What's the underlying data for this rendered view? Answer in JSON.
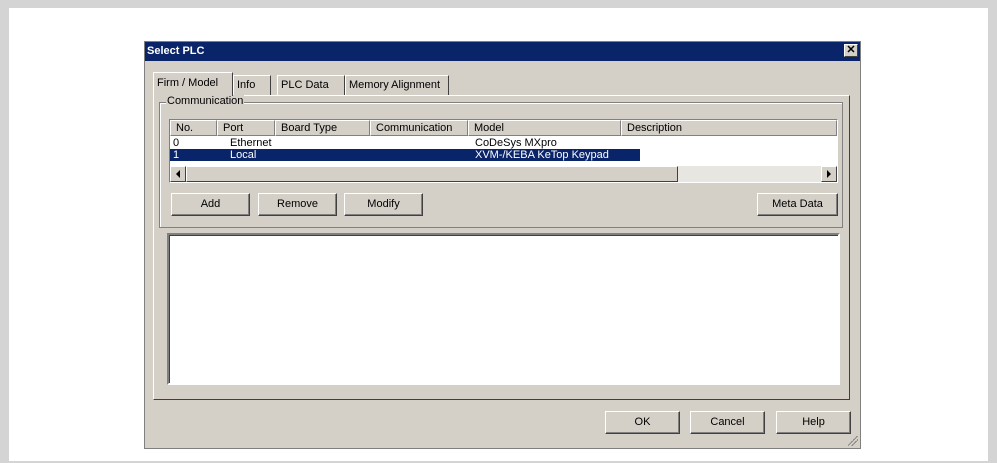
{
  "dialog": {
    "title": "Select PLC",
    "close_glyph": "✕"
  },
  "tabs": [
    {
      "label": "Firm / Model",
      "active": true
    },
    {
      "label": "Info",
      "active": false
    },
    {
      "label": "PLC Data",
      "active": false
    },
    {
      "label": "Memory Alignment",
      "active": false
    }
  ],
  "communication": {
    "group_label": "Communication",
    "columns": [
      "No.",
      "Port",
      "Board Type",
      "Communication",
      "Model",
      "Description"
    ],
    "rows": [
      {
        "no": "0",
        "port": "Ethernet",
        "board_type": "",
        "communication": "",
        "model": "CoDeSys MXpro",
        "description": "",
        "selected": false
      },
      {
        "no": "1",
        "port": "Local",
        "board_type": "",
        "communication": "",
        "model": "XVM-/KEBA KeTop Keypad",
        "description": "",
        "selected": true
      }
    ],
    "scroll_left_icon": "arrow-left",
    "scroll_right_icon": "arrow-right"
  },
  "list_buttons": {
    "add": "Add",
    "remove": "Remove",
    "modify": "Modify",
    "meta_data": "Meta Data"
  },
  "footer_buttons": {
    "ok": "OK",
    "cancel": "Cancel",
    "help": "Help"
  },
  "colors": {
    "titlebar": "#0a246a",
    "selection": "#0a246a",
    "face": "#d4d0c8"
  }
}
